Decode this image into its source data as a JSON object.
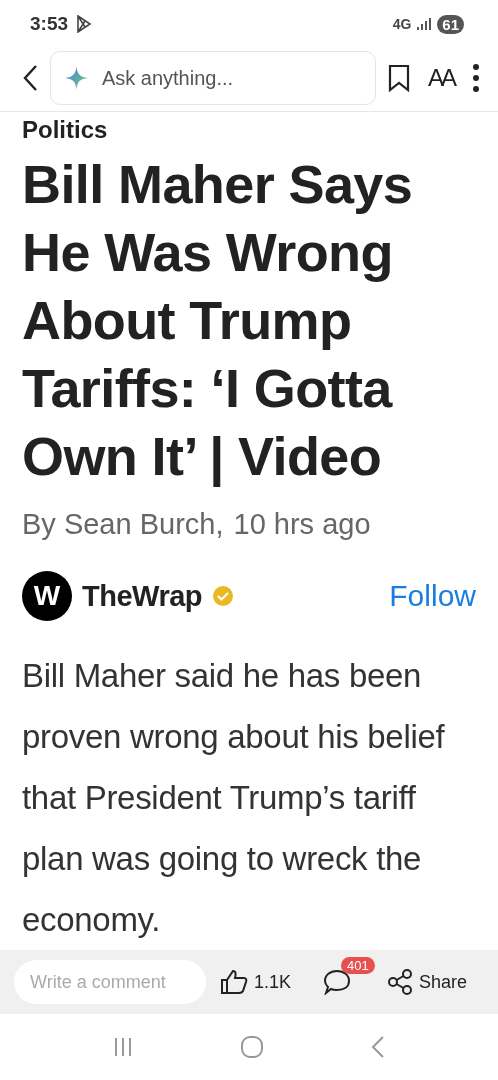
{
  "status_bar": {
    "time": "3:53",
    "network": "4G",
    "battery": "61"
  },
  "toolbar": {
    "search": {
      "placeholder": "Ask anything..."
    },
    "text_size": "AA"
  },
  "article": {
    "category": "Politics",
    "headline": "Bill Maher Says He Was Wrong About Trump Tariffs: ‘I Gotta Own It’ | Video",
    "byline": "By Sean Burch,",
    "time": "10 hrs ago",
    "publisher": {
      "logo": "W",
      "name": "TheWrap",
      "verified": true,
      "follow": "Follow"
    },
    "body": "Bill Maher said he has been proven wrong about his belief that President Trump’s tariff plan was going to wreck the economy."
  },
  "action_bar": {
    "comment": {
      "placeholder": "Write a comment"
    },
    "likes": "1.1K",
    "comment_count": "401",
    "share": "Share"
  }
}
